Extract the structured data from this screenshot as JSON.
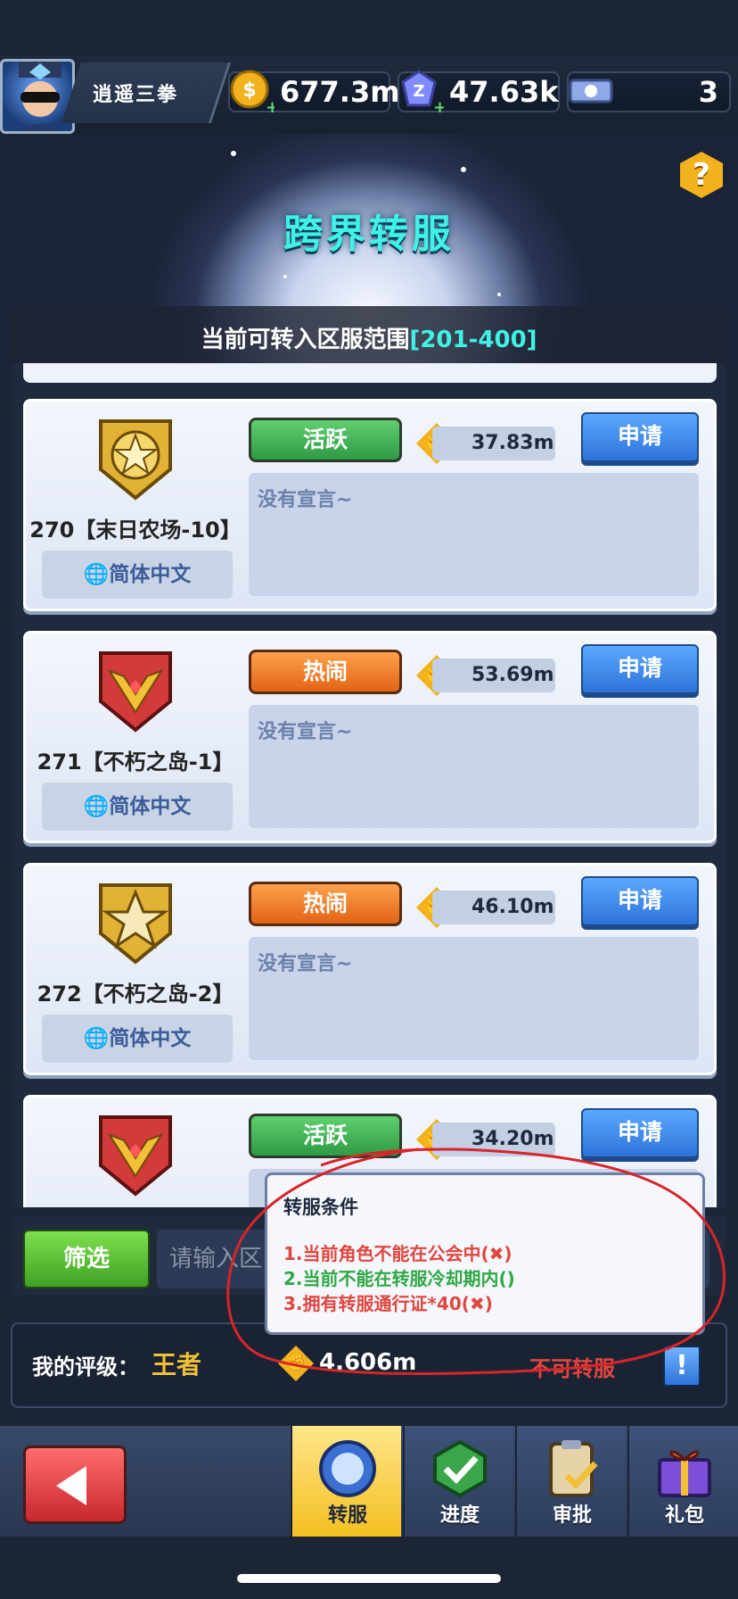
{
  "player": {
    "name": "逍遥三拳"
  },
  "resources": [
    {
      "icon": "gold-coin-icon",
      "value": "677.3m"
    },
    {
      "icon": "gem-icon",
      "value": "47.63k"
    },
    {
      "icon": "ticket-icon",
      "value": "3"
    }
  ],
  "header": {
    "title": "跨界转服",
    "help": "?"
  },
  "range": {
    "prefix": "当前可转入区服范围",
    "value": "[201-400]"
  },
  "servers": [
    {
      "name": "270【末日农场-10】",
      "status": "活跃",
      "status_color": "green",
      "power": "37.83m",
      "apply": "申请",
      "declaration": "没有宣言~",
      "language": "简体中文",
      "badge": "gold-star-shield-icon"
    },
    {
      "name": "271【不朽之岛-1】",
      "status": "热闹",
      "status_color": "orange",
      "power": "53.69m",
      "apply": "申请",
      "declaration": "没有宣言~",
      "language": "简体中文",
      "badge": "red-wing-shield-icon"
    },
    {
      "name": "272【不朽之岛-2】",
      "status": "热闹",
      "status_color": "orange",
      "power": "46.10m",
      "apply": "申请",
      "declaration": "没有宣言~",
      "language": "简体中文",
      "badge": "gold-star-shield-icon"
    },
    {
      "name": "",
      "status": "活跃",
      "status_color": "green",
      "power": "34.20m",
      "apply": "申请",
      "declaration": "",
      "language": "",
      "badge": "red-wing-shield-icon"
    }
  ],
  "filter": {
    "button": "筛选",
    "placeholder": "请输入区"
  },
  "tooltip": {
    "title": "转服条件",
    "conditions": [
      {
        "text": "1.当前角色不能在公会中(✖)",
        "color": "#e0463e"
      },
      {
        "text": "2.当前不能在转服冷却期内()",
        "color": "#2fa845"
      },
      {
        "text": "3.拥有转服通行证*40(✖)",
        "color": "#e0463e"
      }
    ]
  },
  "my": {
    "label": "我的评级：",
    "grade": "王者",
    "power": "4.606m",
    "status": "不可转服",
    "info": "!"
  },
  "nav": {
    "back": "back-arrow-icon",
    "tabs": [
      {
        "label": "转服",
        "icon": "portal-icon",
        "active": true
      },
      {
        "label": "进度",
        "icon": "checkmark-icon",
        "active": false
      },
      {
        "label": "审批",
        "icon": "clipboard-icon",
        "active": false
      },
      {
        "label": "礼包",
        "icon": "gift-icon",
        "active": false
      }
    ]
  },
  "colors": {
    "accent": "#3ff2e5",
    "apply_blue": "#2f74d9",
    "active_green": "#2f9a45",
    "busy_orange": "#e06416",
    "annotation_red": "#d8252a"
  }
}
